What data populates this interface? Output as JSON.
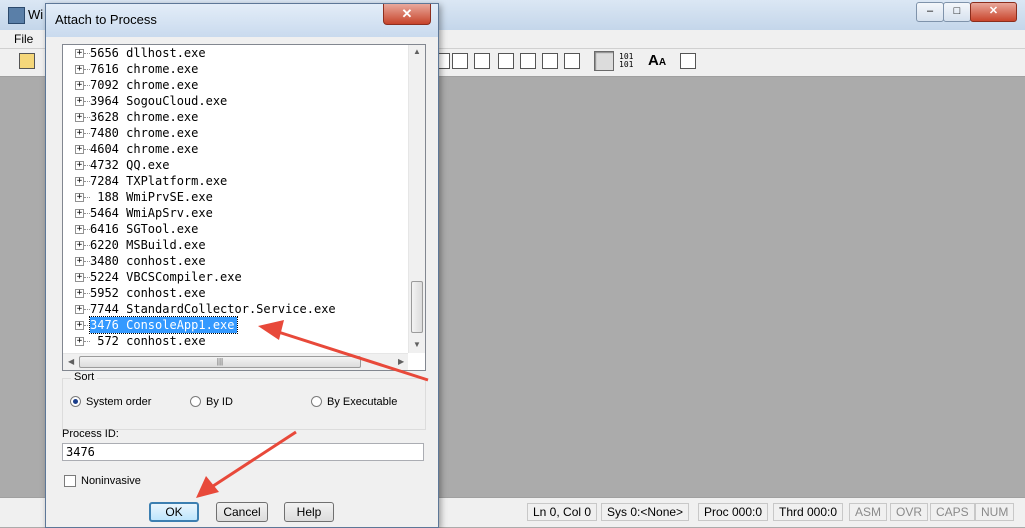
{
  "main_window": {
    "title": "Wi",
    "menu": [
      "File"
    ],
    "statusbar": {
      "position": "Ln 0, Col 0",
      "sys": "Sys 0:<None>",
      "proc": "Proc 000:0",
      "thrd": "Thrd 000:0",
      "asm": "ASM",
      "ovr": "OVR",
      "caps": "CAPS",
      "num": "NUM"
    }
  },
  "dialog": {
    "title": "Attach to Process",
    "processes": [
      {
        "id": "5656",
        "name": "dllhost.exe"
      },
      {
        "id": "7616",
        "name": "chrome.exe"
      },
      {
        "id": "7092",
        "name": "chrome.exe"
      },
      {
        "id": "3964",
        "name": "SogouCloud.exe"
      },
      {
        "id": "3628",
        "name": "chrome.exe"
      },
      {
        "id": "7480",
        "name": "chrome.exe"
      },
      {
        "id": "4604",
        "name": "chrome.exe"
      },
      {
        "id": "4732",
        "name": "QQ.exe"
      },
      {
        "id": "7284",
        "name": "TXPlatform.exe"
      },
      {
        "id": " 188",
        "name": "WmiPrvSE.exe"
      },
      {
        "id": "5464",
        "name": "WmiApSrv.exe"
      },
      {
        "id": "6416",
        "name": "SGTool.exe"
      },
      {
        "id": "6220",
        "name": "MSBuild.exe"
      },
      {
        "id": "3480",
        "name": "conhost.exe"
      },
      {
        "id": "5224",
        "name": "VBCSCompiler.exe"
      },
      {
        "id": "5952",
        "name": "conhost.exe"
      },
      {
        "id": "7744",
        "name": "StandardCollector.Service.exe"
      },
      {
        "id": "3476",
        "name": "ConsoleApp1.exe",
        "selected": true
      },
      {
        "id": " 572",
        "name": "conhost.exe"
      }
    ],
    "sort": {
      "label": "Sort",
      "options": [
        {
          "label": "System order",
          "checked": true
        },
        {
          "label": "By ID",
          "checked": false
        },
        {
          "label": "By Executable",
          "checked": false
        }
      ]
    },
    "process_id_label": "Process ID:",
    "process_id_value": "3476",
    "noninvasive_label": "Noninvasive",
    "noninvasive_checked": false,
    "buttons": {
      "ok": "OK",
      "cancel": "Cancel",
      "help": "Help"
    }
  },
  "annotation_color": "#e8493a"
}
